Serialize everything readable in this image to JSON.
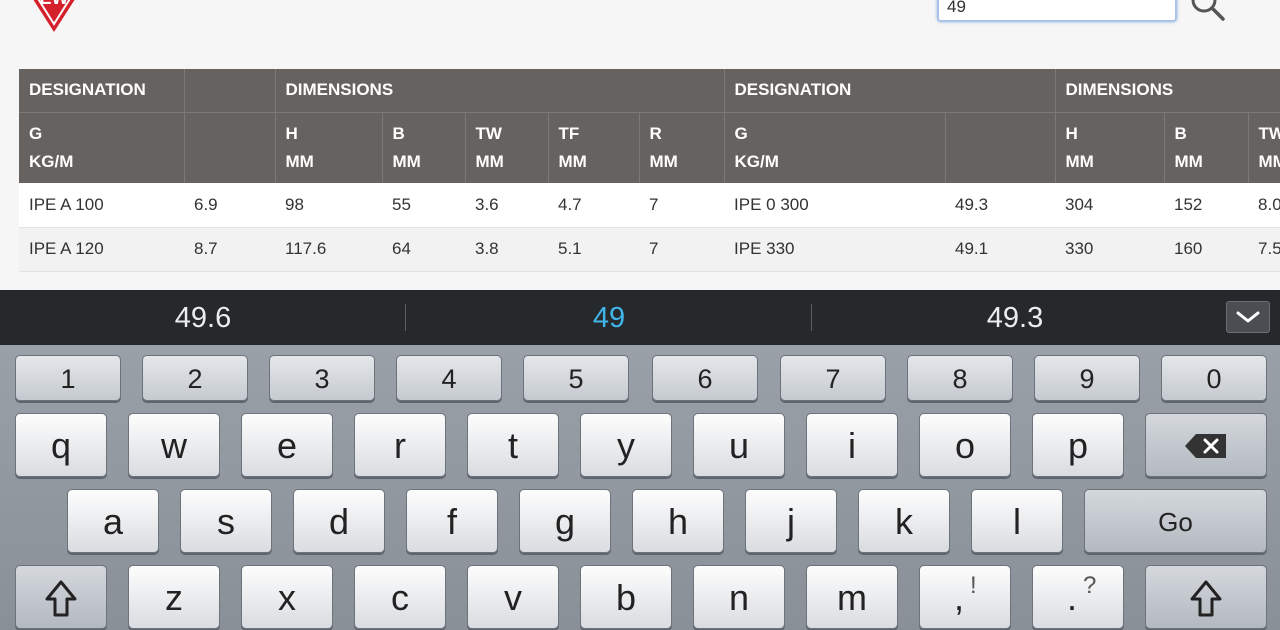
{
  "search": {
    "value": "49"
  },
  "table": {
    "group_headers": [
      "DESIGNATION",
      "",
      "DIMENSIONS",
      "DESIGNATION",
      "DIMENSIONS"
    ],
    "sub_headers": [
      [
        "G",
        "KG/M"
      ],
      [
        "",
        ""
      ],
      [
        "H",
        "MM"
      ],
      [
        "B",
        "MM"
      ],
      [
        "TW",
        "MM"
      ],
      [
        "TF",
        "MM"
      ],
      [
        "R",
        "MM"
      ],
      [
        "G",
        "KG/M"
      ],
      [
        "",
        ""
      ],
      [
        "H",
        "MM"
      ],
      [
        "B",
        "MM"
      ],
      [
        "TW",
        "MM"
      ]
    ],
    "rows": [
      [
        "IPE A 100",
        "6.9",
        "98",
        "55",
        "3.6",
        "4.7",
        "7",
        "IPE 0 300",
        "49.3",
        "304",
        "152",
        "8.0"
      ],
      [
        "IPE A 120",
        "8.7",
        "117.6",
        "64",
        "3.8",
        "5.1",
        "7",
        "IPE 330",
        "49.1",
        "330",
        "160",
        "7.5"
      ]
    ]
  },
  "suggestions": [
    "49.6",
    "49",
    "49.3"
  ],
  "keyboard": {
    "numbers": [
      "1",
      "2",
      "3",
      "4",
      "5",
      "6",
      "7",
      "8",
      "9",
      "0"
    ],
    "row1": [
      "q",
      "w",
      "e",
      "r",
      "t",
      "y",
      "u",
      "i",
      "o",
      "p"
    ],
    "row2": [
      "a",
      "s",
      "d",
      "f",
      "g",
      "h",
      "j",
      "k",
      "l"
    ],
    "row3": [
      "z",
      "x",
      "c",
      "v",
      "b",
      "n",
      "m"
    ],
    "go_label": "Go",
    "comma_alt": "!",
    "period_alt": "?"
  },
  "colors": {
    "header_bg": "#666260",
    "accent_suggestion": "#3fb5ea",
    "logo_red": "#d4202a"
  }
}
